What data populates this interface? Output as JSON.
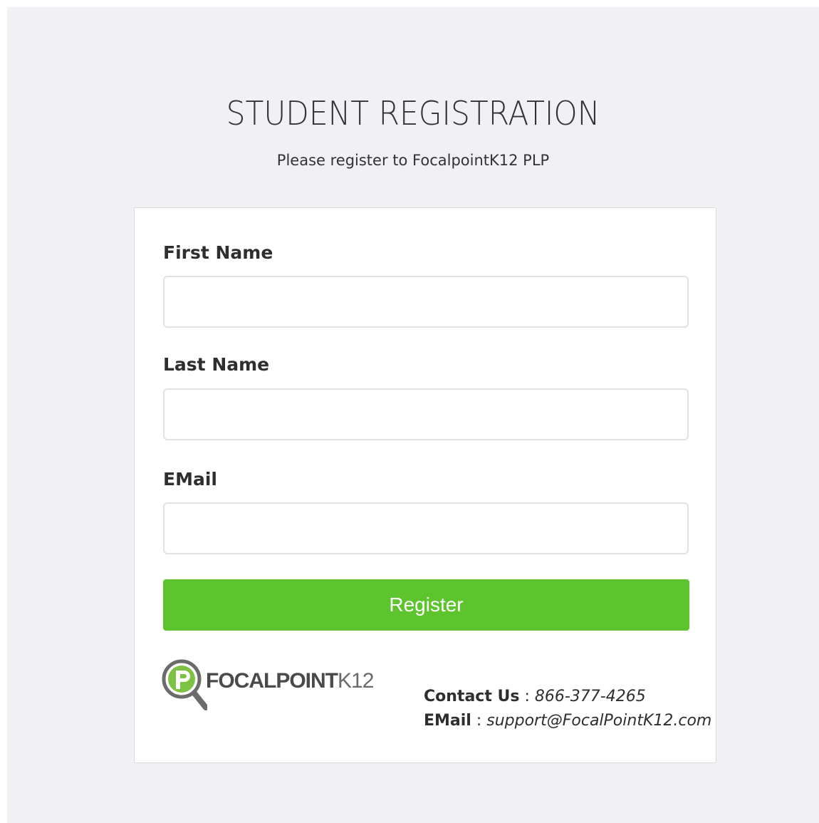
{
  "page": {
    "title": "STUDENT REGISTRATION",
    "subtitle": "Please register to FocalpointK12 PLP"
  },
  "form": {
    "first_name": {
      "label": "First Name",
      "value": "",
      "placeholder": ""
    },
    "last_name": {
      "label": "Last Name",
      "value": "",
      "placeholder": ""
    },
    "email": {
      "label": "EMail",
      "value": "",
      "placeholder": ""
    },
    "submit_label": "Register"
  },
  "logo": {
    "bold": "FOCALPOINT",
    "light": "K12"
  },
  "contact": {
    "phone_label": "Contact Us",
    "phone_sep": " : ",
    "phone": "866-377-4265",
    "email_label": "EMail",
    "email_sep": " : ",
    "email": "support@FocalPointK12.com"
  },
  "colors": {
    "background": "#f0f0f5",
    "card": "#ffffff",
    "accent": "#5ec42e",
    "text": "#333333"
  },
  "icons": [
    "focalpoint-magnifier-logo-icon"
  ]
}
